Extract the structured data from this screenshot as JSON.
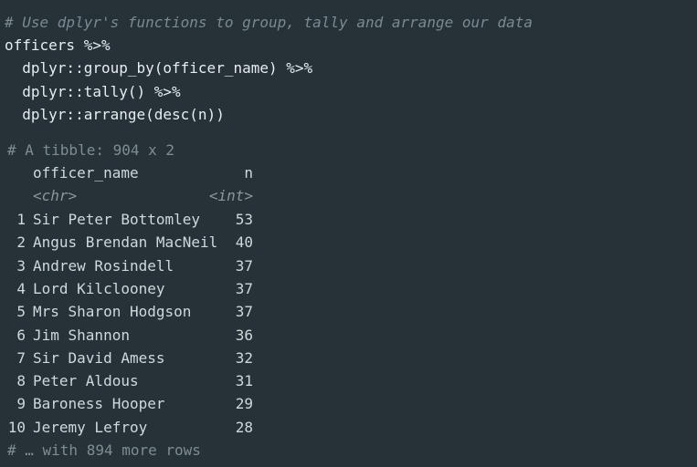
{
  "code": {
    "comment": "# Use dplyr's functions to group, tally and arrange our data",
    "line1": "officers %>%",
    "line2": "  dplyr::group_by(officer_name) %>%",
    "line3": "  dplyr::tally() %>%",
    "line4": "  dplyr::arrange(desc(n))"
  },
  "output": {
    "header": "# A tibble: 904 x 2",
    "columns": [
      "officer_name",
      "n"
    ],
    "types": [
      "<chr>",
      "<int>"
    ],
    "rows": [
      {
        "idx": "1",
        "name": "Sir Peter Bottomley",
        "n": "53"
      },
      {
        "idx": "2",
        "name": "Angus Brendan MacNeil",
        "n": "40"
      },
      {
        "idx": "3",
        "name": "Andrew Rosindell",
        "n": "37"
      },
      {
        "idx": "4",
        "name": "Lord Kilclooney",
        "n": "37"
      },
      {
        "idx": "5",
        "name": "Mrs Sharon Hodgson",
        "n": "37"
      },
      {
        "idx": "6",
        "name": "Jim Shannon",
        "n": "36"
      },
      {
        "idx": "7",
        "name": "Sir David Amess",
        "n": "32"
      },
      {
        "idx": "8",
        "name": "Peter Aldous",
        "n": "31"
      },
      {
        "idx": "9",
        "name": "Baroness Hooper",
        "n": "29"
      },
      {
        "idx": "10",
        "name": "Jeremy Lefroy",
        "n": "28"
      }
    ],
    "footer": "# … with 894 more rows"
  },
  "colors": {
    "background": "#263238",
    "comment": "#7b8a90",
    "text": "#e6edf0"
  }
}
